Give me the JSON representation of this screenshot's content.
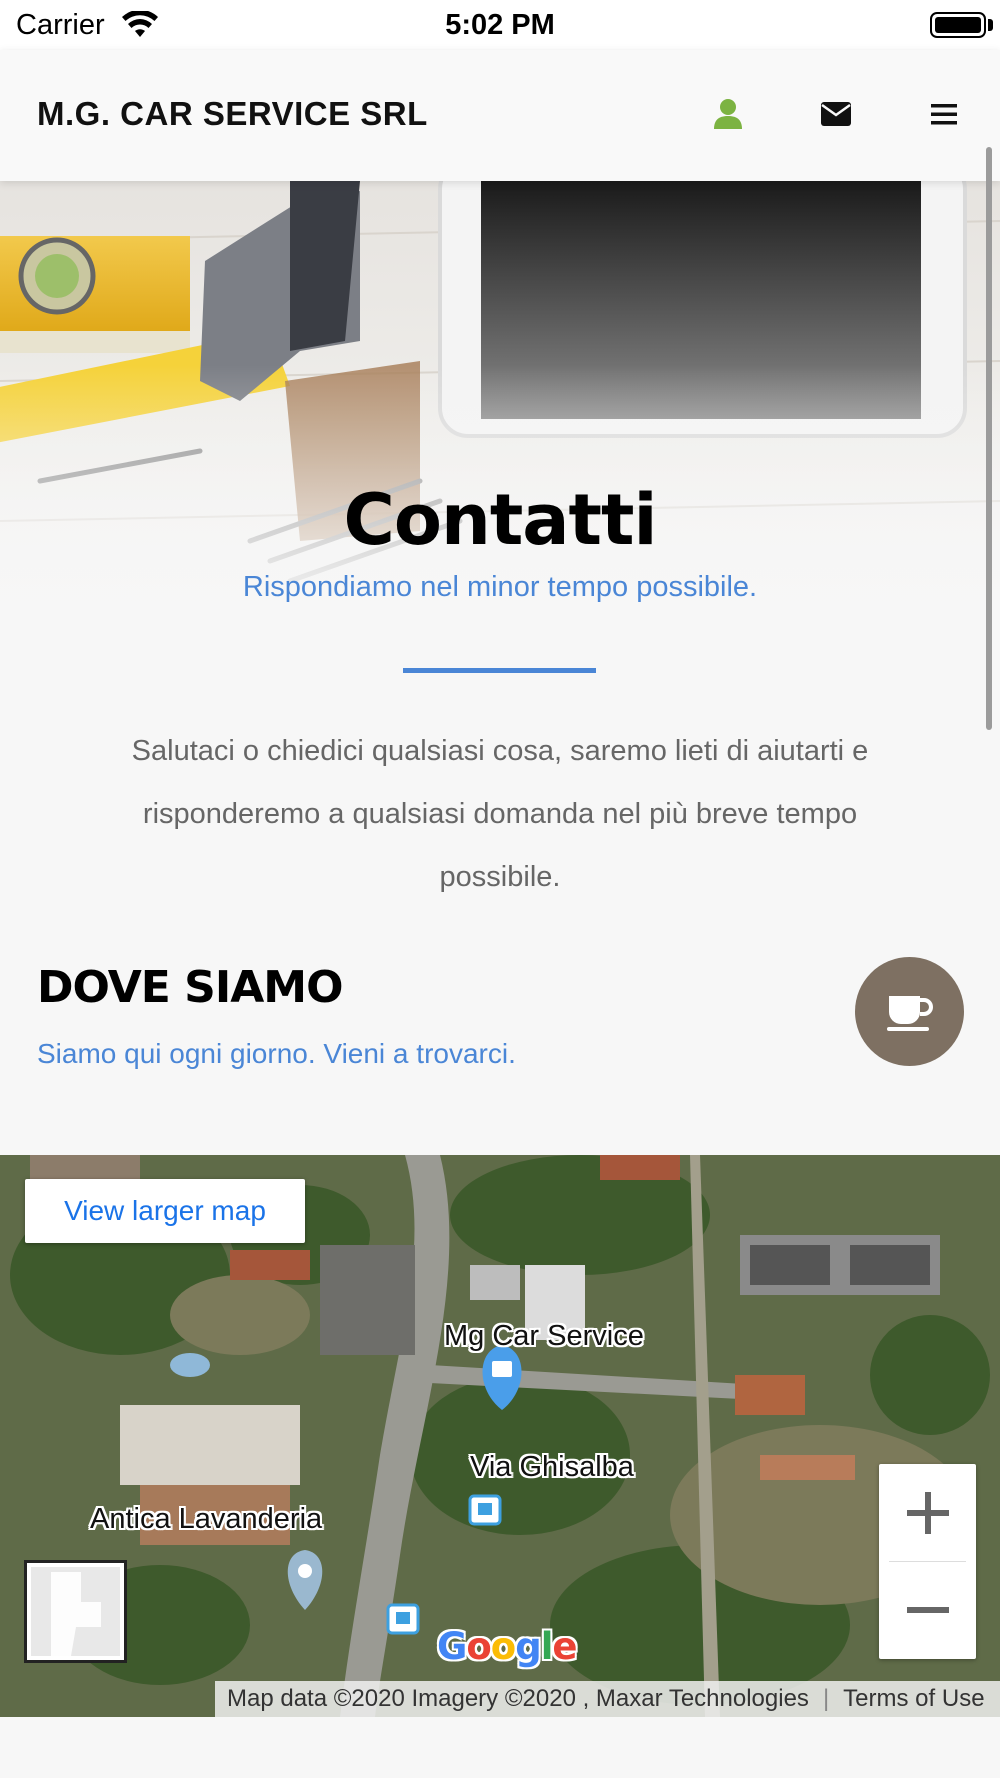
{
  "status_bar": {
    "carrier": "Carrier",
    "time": "5:02 PM"
  },
  "navbar": {
    "brand": "M.G. CAR SERVICE SRL",
    "icons": [
      "user-icon",
      "envelope-icon",
      "hamburger-menu-icon"
    ],
    "user_icon_color": "#7cb342"
  },
  "hero": {
    "title": "Contatti",
    "subtitle": "Rispondiamo nel minor tempo possibile."
  },
  "intro": {
    "text": "Salutaci o chiedici qualsiasi cosa, saremo lieti di aiutarti e risponderemo a qualsiasi domanda nel più breve tempo possibile."
  },
  "location": {
    "title": "DOVE SIAMO",
    "subtitle": "Siamo qui ogni giorno. Vieni a trovarci.",
    "fab_icon": "coffee-cup-icon"
  },
  "map": {
    "view_larger": "View larger map",
    "labels": {
      "business": "Mg Car Service",
      "street": "Via Ghisalba",
      "poi": "Antica Lavanderia"
    },
    "zoom_in": "+",
    "zoom_out": "−",
    "logo": "Google",
    "attribution": "Map data ©2020 Imagery ©2020 , Maxar Technologies",
    "terms": "Terms of Use"
  },
  "colors": {
    "accent": "#4a86d6",
    "fab": "#7e7062",
    "text_muted": "#666666"
  }
}
